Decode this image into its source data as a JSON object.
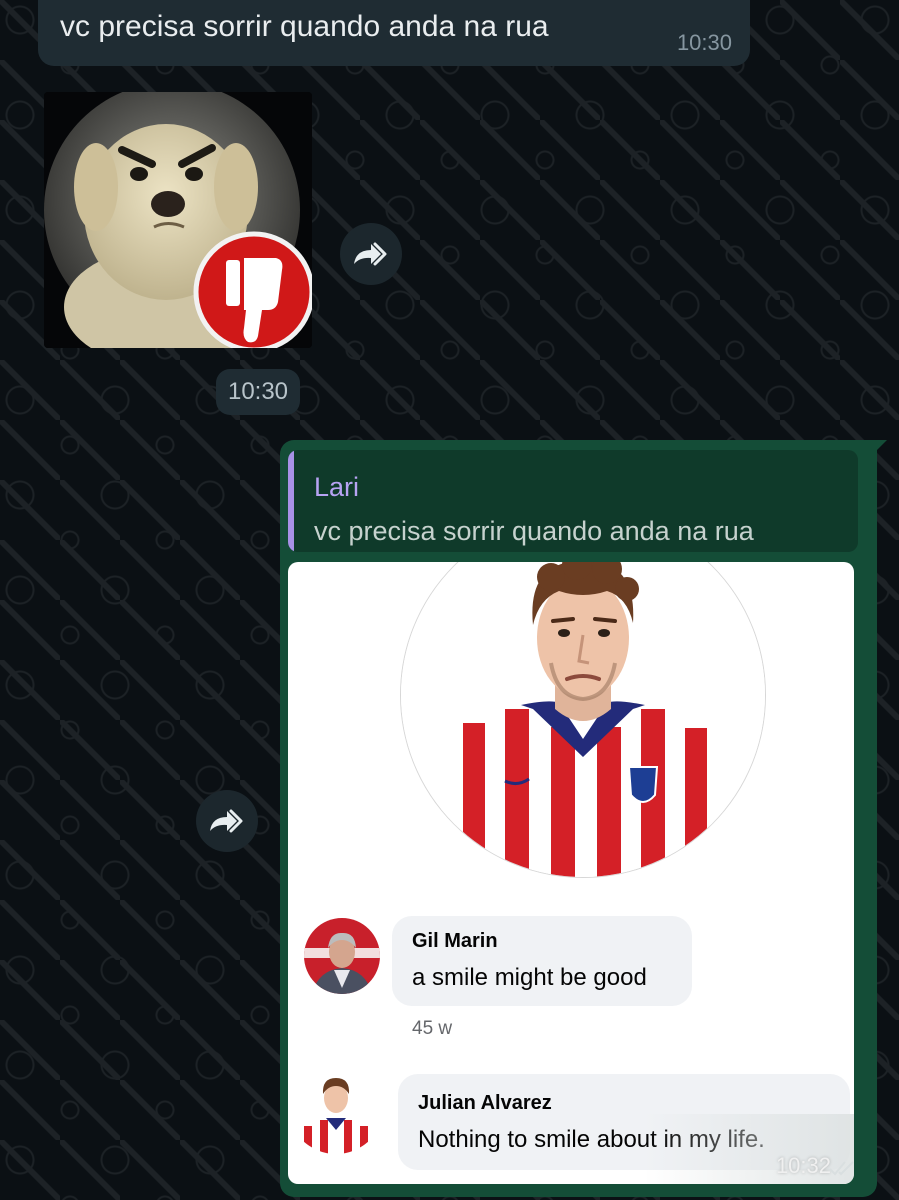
{
  "messages": {
    "incoming_text": {
      "text": "vc precisa sorrir quando anda na rua",
      "time": "10:30"
    },
    "incoming_sticker": {
      "time": "10:30"
    },
    "outgoing": {
      "reply_to": {
        "author": "Lari",
        "text": "vc precisa sorrir quando anda na rua"
      },
      "time": "10:32",
      "screenshot": {
        "comments": [
          {
            "name": "Gil Marin",
            "text": "a smile might be good",
            "age": "45 w"
          },
          {
            "name": "Julian Alvarez",
            "text": "Nothing to smile about in my life."
          }
        ]
      }
    }
  },
  "colors": {
    "chat_background": "#0b1014",
    "incoming_bubble": "#1f2c33",
    "outgoing_bubble": "#144d37",
    "quote_bar": "#a791e6",
    "quote_author": "#b7a3f3"
  },
  "icons": {
    "forward": "forward-icon",
    "read_receipt": "double-check-icon",
    "dislike": "thumbs-down-icon"
  }
}
